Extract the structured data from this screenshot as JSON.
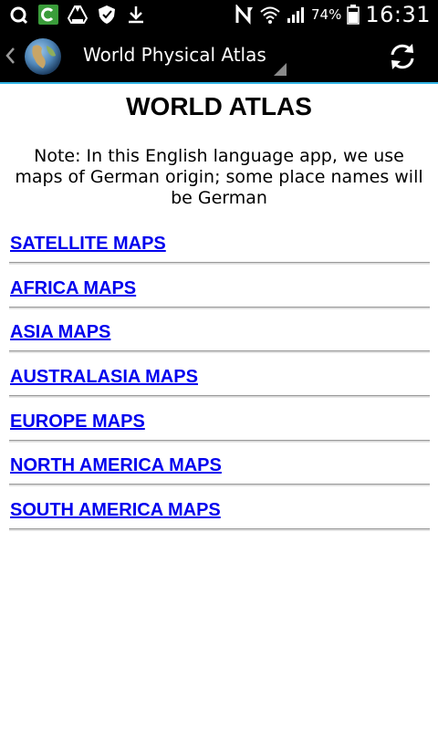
{
  "status_bar": {
    "icons": [
      "q-notification-icon",
      "c-app-icon",
      "drive-icon",
      "shield-icon",
      "download-icon",
      "nfc-icon",
      "wifi-icon",
      "signal-icon",
      "battery-icon"
    ],
    "battery_percent": "74%",
    "time": "16:31"
  },
  "action_bar": {
    "title": "World Physical Atlas",
    "icons": [
      "back-chevron-icon",
      "globe-icon",
      "refresh-icon"
    ]
  },
  "page": {
    "title": "WORLD ATLAS",
    "note": "Note: In this English language app, we use maps of German origin; some place names will be German"
  },
  "map_links": [
    "SATELLITE MAPS",
    "AFRICA MAPS",
    "ASIA MAPS",
    "AUSTRALASIA MAPS",
    "EUROPE MAPS",
    "NORTH AMERICA MAPS",
    "SOUTH AMERICA MAPS"
  ],
  "colors": {
    "accent": "#33b5e5",
    "link": "#0000ee",
    "bar_background": "#000000"
  }
}
